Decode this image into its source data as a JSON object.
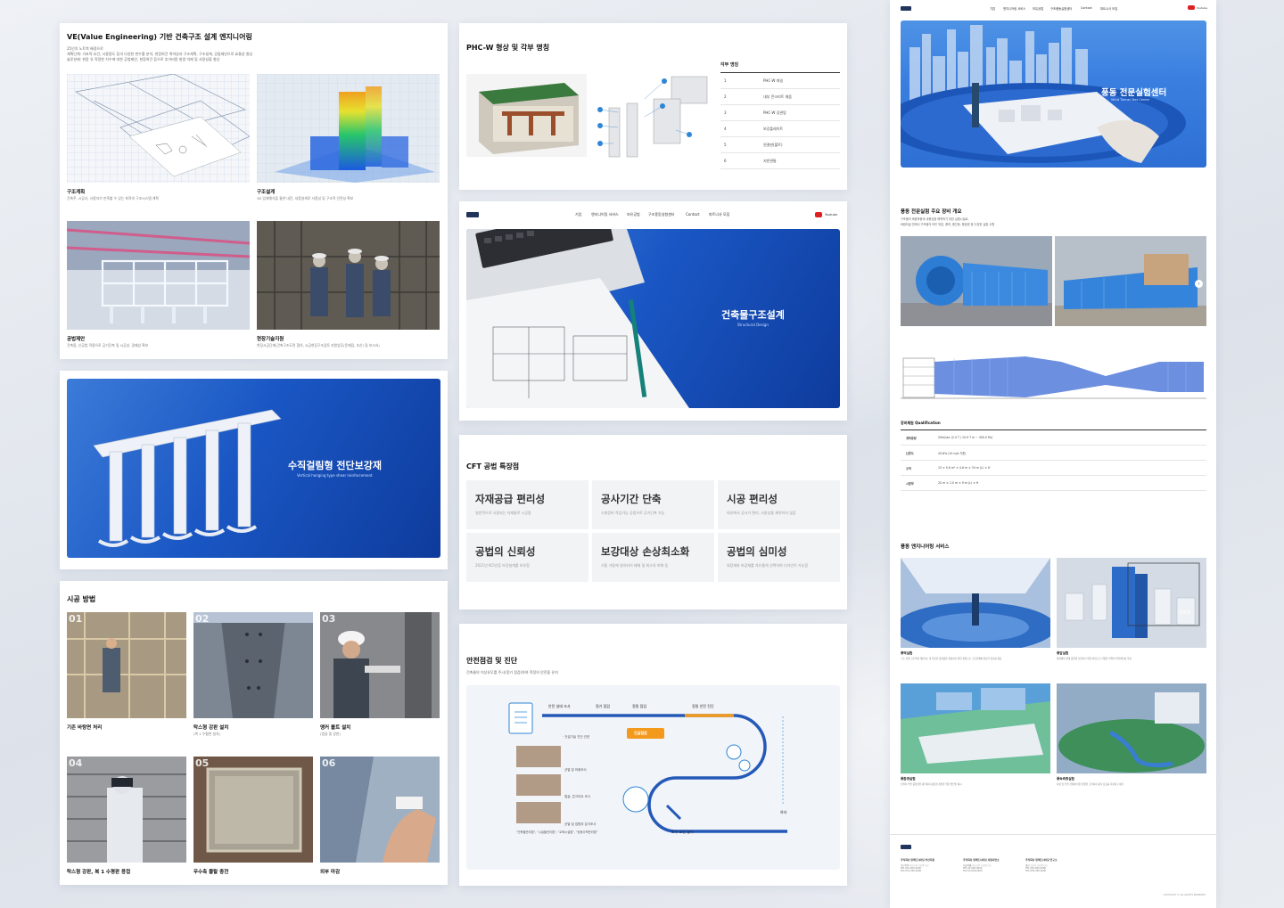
{
  "card1": {
    "title": "VE(Value Engineering) 기반 건축구조 설계 엔지니어링",
    "desc": [
      "25인치 노트북 배경으로",
      "계획단계: 기초적 요건, 사용용도 등의 다양한 변수를 분석, 현장여건 취약성과 구조계획, 구조설계, 공법제안으로 효율성 향상",
      "솔루션제: 현장 유 적정한 치수에 대한 공법제안, 현장여건 등으로 추가비용 발생 억제 및 사용성을 향상"
    ],
    "items": [
      {
        "label": "구조계획",
        "sub": "건축주, 시공사, 사용자가 만족할 수 있는 최적의 구조시스템 계획"
      },
      {
        "label": "구조설계",
        "sub": "3D 입체해석을 통한 내진, 내풍설계로 사용성 및 구조적 안전성 확보"
      },
      {
        "label": "공법제안",
        "sub": "건축용, 신공법 적용으로 공기단축 및 시공성, 경제성 확보"
      },
      {
        "label": "현장기술지원",
        "sub": "현장시공단계(건축구조도면 협의, 시공현장구조검토 지원업무(문제점, 추산) 및 보고서)"
      }
    ]
  },
  "card2": {
    "title": "수직걸림형 전단보강재",
    "subtitle": "Vertical hanging type shear reinforcement"
  },
  "card3": {
    "title": "시공 방법",
    "steps": [
      {
        "num": "01",
        "label": "기존 바탕면 처리",
        "sub": ""
      },
      {
        "num": "02",
        "label": "탁스형 강판 설치",
        "sub": "(복 1 수평판 설치)"
      },
      {
        "num": "03",
        "label": "앵커 볼트 설치",
        "sub": "(앵글 및 강판)"
      },
      {
        "num": "04",
        "label": "탁스형 강판, 복 1 수평판 용접",
        "sub": ""
      },
      {
        "num": "05",
        "label": "무수축 몰탈 충전",
        "sub": ""
      },
      {
        "num": "06",
        "label": "외부 마감",
        "sub": ""
      }
    ]
  },
  "card4": {
    "title": "PHC-W 형상 및 각부 명칭",
    "table_title": "각부 명칭",
    "rows": [
      {
        "n": "1",
        "name": "PHC-W 파일"
      },
      {
        "n": "2",
        "name": "내부 콘크리트 채움"
      },
      {
        "n": "3",
        "name": "PHC-W 강관망"
      },
      {
        "n": "4",
        "name": "보강플레이트"
      },
      {
        "n": "5",
        "name": "연결판(볼트)"
      },
      {
        "n": "6",
        "name": "지반관통"
      }
    ]
  },
  "card5": {
    "nav": [
      "기업",
      "엔지니어링 서비스",
      "보유공법",
      "구조풍동실험센터",
      "Contact",
      "파트너사 모집"
    ],
    "youtube": "Youtube",
    "hero_title": "건축물구조설계",
    "hero_sub": "Structural Design"
  },
  "card6": {
    "title": "CFT 공법 특장점",
    "features": [
      {
        "t": "자재공급 편리성",
        "s": "일반적으로 사용되는 자재들로 시공함"
      },
      {
        "t": "공사기간 단축",
        "s": "소형장비 작업가능 공법으로 공기단축 가능"
      },
      {
        "t": "시공 편리성",
        "s": "외부에서 공사가 편리, 사용성을 제약하지 않음"
      },
      {
        "t": "공법의 신뢰성",
        "s": "2021년 KCI인증 보강설계를 보유함"
      },
      {
        "t": "보강대상 손상최소화",
        "s": "기둥 기둥에 설치되어 배제 및 최소의 피해 등"
      },
      {
        "t": "공법의 심미성",
        "s": "외장재와 마감재를 자유롭게 선택하여 디자인이 가능함"
      }
    ]
  },
  "card7": {
    "title": "안전점검 및 진단",
    "desc": "건축물의 이상유무를 주시(정기 점검)하여 적정의 안전을 유지",
    "labels": [
      "안전 실태 조사",
      "정기 점검",
      "정밀 점검",
      "정밀 안전 진단",
      "긴급점검",
      "하자",
      "보수 보강 실시"
    ],
    "notes": [
      "· 건설기술 진단 관련",
      "균열 및 하중조사",
      "철골, 콘크리트 조사",
      "균열 및 접합부 분석조사"
    ],
    "footer": "\"건축물관리법\", \"시설물관리법\", \"교육시설법\", \"공동주택관리법\""
  },
  "card8": {
    "nav": [
      "기업",
      "엔지니어링 서비스",
      "보유공법",
      "구조풍동실험센터",
      "Contact",
      "파트너사 모집"
    ],
    "youtube": "Youtube",
    "hero_title": "풍동 전문실험센터",
    "hero_sub": "Wind Tunnel Test Center",
    "s1_title": "풍동 전문실험 주요 장비 개요",
    "s1_desc": [
      "구조물의 바람하중과 내풍성을 예측하기 위한 실험시설로,",
      "바람터널 안에서 구조물의 모든 외압, 풍력, 풍진동, 풍환경 등 다양한 실험 수행"
    ],
    "spec_title": "장비제원 Qualification",
    "specs": [
      {
        "k": "계측용량",
        "v": "20m/sec (2.0 T / 10.9 T m ~ 450.0 Pa)"
      },
      {
        "k": "난류도",
        "v": "43.8% (10 m/s 기준)"
      },
      {
        "k": "규격",
        "v": "15 × 5.6 m² × 4.6 m × 34 m (L) × H"
      },
      {
        "k": "시험부",
        "v": "20 m × 2.0 m × 9 m (L) × H"
      }
    ],
    "s2_title": "풍동 엔지니어링 서비스",
    "services": [
      {
        "t": "풍력실험",
        "s": "구조 설계 구조부재 계산하는 데 필요한 풍하중을 결정하기 위한 실험으로 구조설계에 필요한 정보를 제공"
      },
      {
        "t": "풍압실험",
        "s": "외장재의 설계 풍압을 산출하기 위한 실험으로 다양한 부위의 압력계수를 측정"
      },
      {
        "t": "풍환경실험",
        "s": "보행자 주변 풍환경을 평가하여 풍환경 개선을 위한 방안을 제시"
      },
      {
        "t": "풍속측정실험",
        "s": "지형 및 주변 건물에 의한 영향을 고려하여 풍속 분포를 측정하고 평가"
      }
    ],
    "label_yd": "양력부",
    "footer_cols": [
      {
        "t": "주식회사 일렉트니어링 부산지점",
        "l": [
          "부산광역시 ○○구 ○○로 ○○",
          "TEL 051-000-0000",
          "FAX 051-000-0000"
        ]
      },
      {
        "t": "주식회사 일렉트니어링 서울사업소",
        "l": [
          "서울특별시 ○○구 ○○로 ○○",
          "TEL 02-000-0000",
          "FAX 02-000-0000"
        ]
      },
      {
        "t": "주식회사 일렉트니어링 연구소",
        "l": [
          "경남 ○○시 ○○로 ○○",
          "TEL 055-000-0000",
          "FAX 055-000-0000"
        ]
      }
    ],
    "copyright": "COPYRIGHT © ALL RIGHTS RESERVED"
  }
}
